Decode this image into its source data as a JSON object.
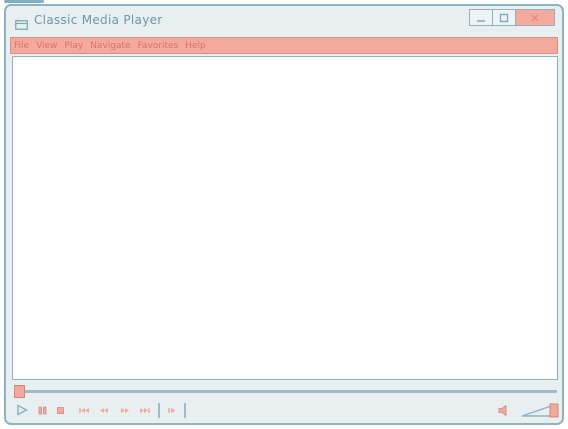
{
  "window": {
    "title": "Classic Media Player",
    "minimize_label": "—",
    "maximize_label": "□",
    "close_label": "×"
  },
  "menu": [
    {
      "label": "File"
    },
    {
      "label": "View"
    },
    {
      "label": "Play"
    },
    {
      "label": "Navigate"
    },
    {
      "label": "Favorites"
    },
    {
      "label": "Help"
    }
  ],
  "playback": {
    "seek_position": 0,
    "volume_level": 1.0
  },
  "icons": {
    "app": "media-app-icon",
    "play": "play-icon",
    "pause": "pause-icon",
    "stop": "stop-icon",
    "previous": "skip-previous-icon",
    "rewind": "rewind-icon",
    "fast_forward": "fast-forward-icon",
    "next": "skip-next-icon",
    "frame_step": "frame-step-icon",
    "mute": "speaker-icon"
  },
  "colors": {
    "accent": "#f4a99d",
    "accent_text": "#d77467",
    "outline": "#8fb3bd",
    "chrome": "#e7eff1"
  }
}
